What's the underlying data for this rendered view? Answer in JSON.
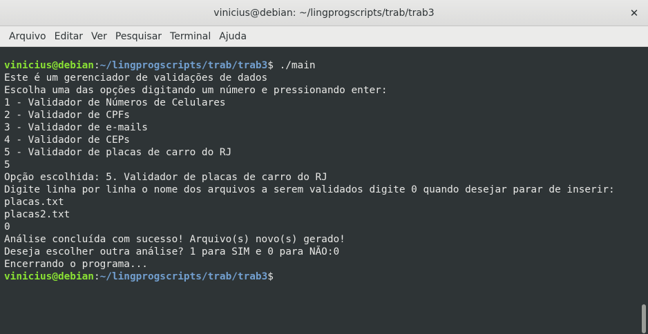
{
  "window": {
    "title": "vinicius@debian: ~/lingprogscripts/trab/trab3",
    "close_glyph": "✕"
  },
  "menubar": {
    "items": [
      "Arquivo",
      "Editar",
      "Ver",
      "Pesquisar",
      "Terminal",
      "Ajuda"
    ]
  },
  "terminal": {
    "prompt": {
      "user_host": "vinicius@debian",
      "separator": ":",
      "path": "~/lingprogscripts/trab/trab3",
      "symbol": "$"
    },
    "command": " ./main",
    "output_lines": [
      "Este é um gerenciador de validações de dados",
      "Escolha uma das opções digitando um número e pressionando enter:",
      "1 - Validador de Números de Celulares",
      "2 - Validador de CPFs",
      "3 - Validador de e-mails",
      "4 - Validador de CEPs",
      "5 - Validador de placas de carro do RJ",
      "5",
      "Opção escolhida: 5. Validador de placas de carro do RJ",
      "Digite linha por linha o nome dos arquivos a serem validados digite 0 quando desejar parar de inserir:",
      "placas.txt",
      "placas2.txt",
      "0",
      "Análise concluída com sucesso! Arquivo(s) novo(s) gerado!",
      "Deseja escolher outra análise? 1 para SIM e 0 para NÃO:0",
      "Encerrando o programa..."
    ],
    "colors": {
      "background": "#2e3436",
      "foreground": "#e8e8e6",
      "prompt_user": "#8ae234",
      "prompt_path": "#729fcf"
    }
  }
}
